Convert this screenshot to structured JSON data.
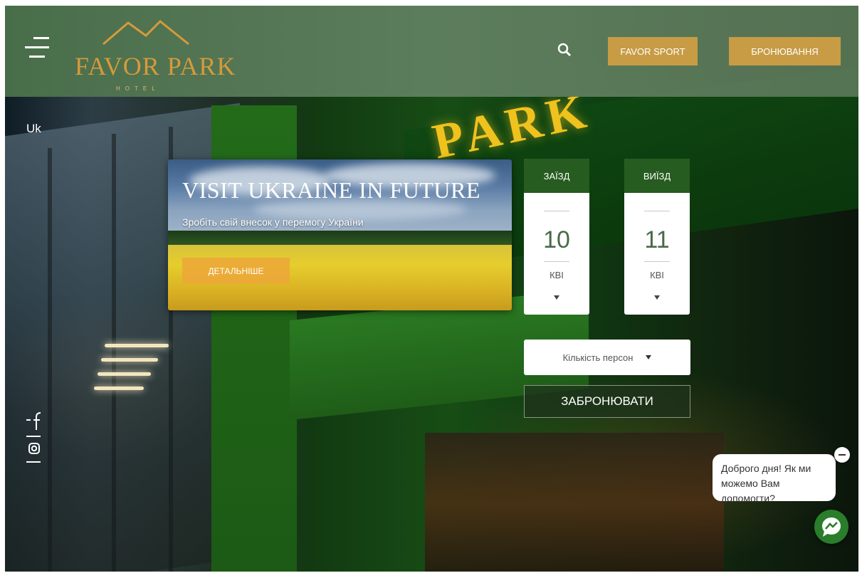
{
  "header": {
    "logo_text": "FAVOR PARK",
    "logo_sub": "HOTEL",
    "favor_sport_label": "FAVOR SPORT",
    "booking_label": "БРОНЮВАННЯ",
    "icons": {
      "menu": "menu-icon",
      "search": "search-icon"
    }
  },
  "language": "Uk",
  "promo": {
    "title": "VISIT UKRAINE IN FUTURE",
    "subtitle": "Зробіть свій внесок у перемогу України",
    "button_label": "ДЕТАЛЬНІШЕ"
  },
  "checkin": {
    "label": "ЗАЇЗД",
    "day": "10",
    "month": "КВІ"
  },
  "checkout": {
    "label": "ВИЇЗД",
    "day": "11",
    "month": "КВІ"
  },
  "persons_label": "Кількість персон",
  "book_button_label": "ЗАБРОНЮВАТИ",
  "social": [
    "facebook-icon",
    "instagram-icon"
  ],
  "chat": {
    "message": "Доброго дня! Як ми можемо Вам допомогти?"
  },
  "colors": {
    "accent": "#c79c45",
    "header_green": "#5a7d58",
    "date_head": "#265c1f"
  }
}
